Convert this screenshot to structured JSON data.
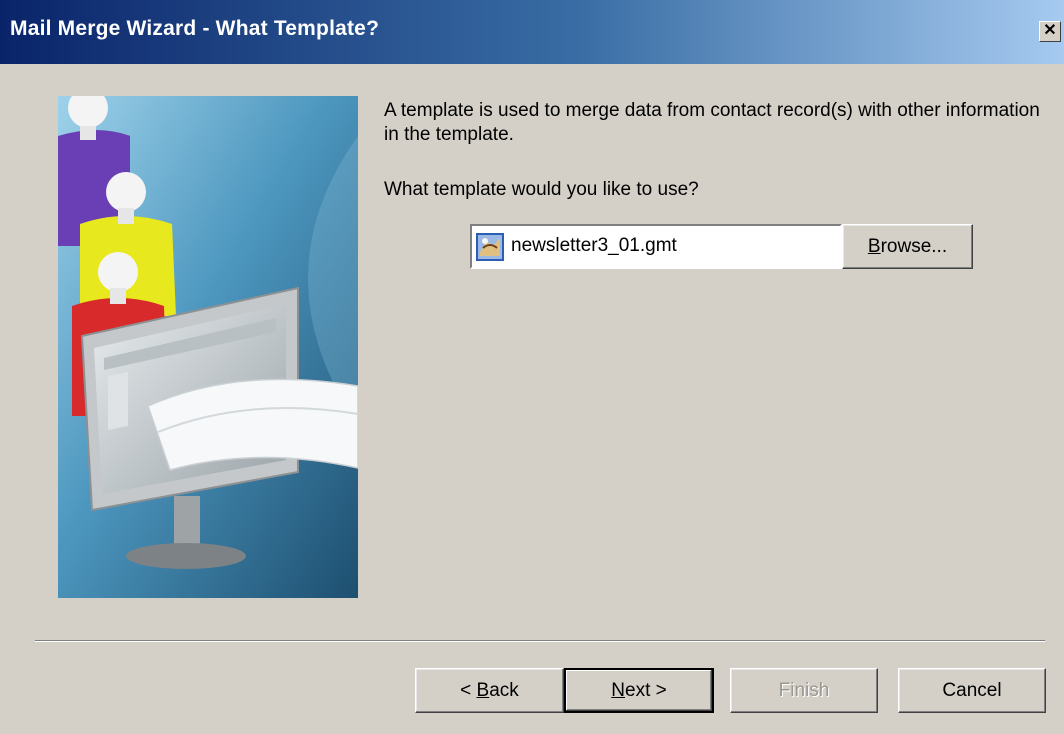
{
  "window": {
    "title": "Mail Merge Wizard - What Template?",
    "close_label": "✕"
  },
  "main": {
    "intro_text": "A template is used to merge data from contact record(s) with other information in the template.",
    "question_text": "What template would you like to use?",
    "template_field": {
      "value": "newsletter3_01.gmt",
      "icon": "template-file-icon"
    },
    "browse_button": {
      "label_accel": "B",
      "label_rest": "rowse..."
    }
  },
  "footer": {
    "back_button": {
      "prefix": "< ",
      "accel": "B",
      "rest": "ack"
    },
    "next_button": {
      "accel": "N",
      "rest": "ext >"
    },
    "finish_label": "Finish",
    "cancel_label": "Cancel"
  },
  "colors": {
    "title_gradient_start": "#0a246a",
    "title_gradient_end": "#a6caf0",
    "dialog_face": "#d4d0c8"
  }
}
